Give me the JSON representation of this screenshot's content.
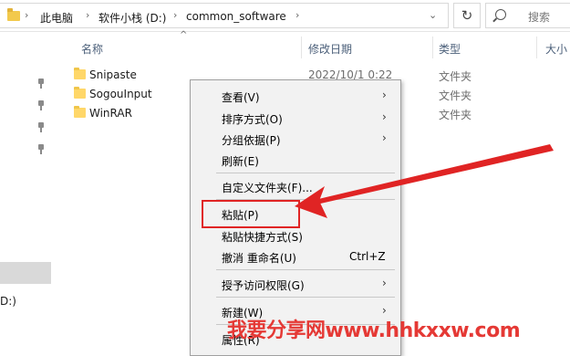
{
  "breadcrumb": {
    "items": [
      "此电脑",
      "软件小栈 (D:)",
      "common_software"
    ]
  },
  "search": {
    "placeholder": "搜索"
  },
  "nav": {
    "drive_label": "D:)"
  },
  "columns": {
    "name": "名称",
    "date": "修改日期",
    "type": "类型",
    "size": "大小"
  },
  "files": [
    {
      "name": "Snipaste",
      "date": "2022/10/1 0:22",
      "type": "文件夹"
    },
    {
      "name": "SogouInput",
      "date": "",
      "type": "文件夹"
    },
    {
      "name": "WinRAR",
      "date": "",
      "type": "文件夹"
    }
  ],
  "context_menu": {
    "view": "查看(V)",
    "sort": "排序方式(O)",
    "group": "分组依据(P)",
    "refresh": "刷新(E)",
    "customize": "自定义文件夹(F)...",
    "paste": "粘贴(P)",
    "paste_shortcut": "粘贴快捷方式(S)",
    "undo": "撤消 重命名(U)",
    "undo_shortcut": "Ctrl+Z",
    "grant_access": "授予访问权限(G)",
    "new": "新建(W)",
    "properties": "属性(R)"
  },
  "watermark": "我要分享网www.hhkxxw.com",
  "colors": {
    "highlight": "#e02424",
    "watermark": "#e53935",
    "menu_bg": "#f2f2f2",
    "folder": "#ffd769"
  },
  "icons": [
    "folder-icon",
    "search-icon",
    "refresh-icon",
    "pin-icon",
    "chevron-right-icon",
    "chevron-down-icon"
  ]
}
